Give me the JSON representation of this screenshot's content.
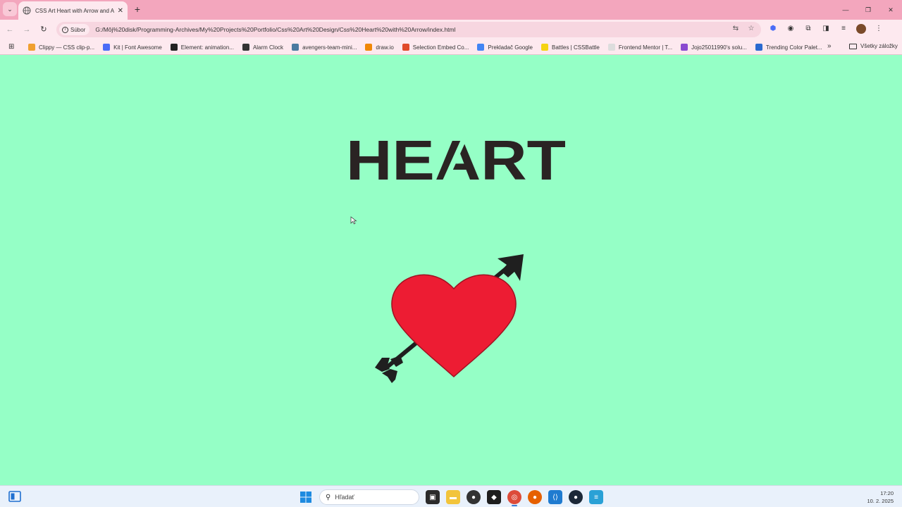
{
  "browser": {
    "tab": {
      "title": "CSS Art Heart with Arrow and A"
    },
    "address": {
      "chip": "Súbor",
      "url": "G:/Môj%20disk/Programming-Archives/My%20Projects%20Portfolio/Css%20Art%20Design/Css%20Heart%20with%20Arrow/index.html"
    },
    "bookmarks": [
      {
        "label": "Clippy — CSS clip-p...",
        "color": "#f0a030"
      },
      {
        "label": "Kit | Font Awesome",
        "color": "#4a6cf7"
      },
      {
        "label": "Element: animation...",
        "color": "#222222"
      },
      {
        "label": "Alarm Clock",
        "color": "#333333"
      },
      {
        "label": "avengers-team-mini...",
        "color": "#4a7aa0"
      },
      {
        "label": "draw.io",
        "color": "#f08705"
      },
      {
        "label": "Selection Embed Co...",
        "color": "#e04a2a"
      },
      {
        "label": "Prekladač Google",
        "color": "#4285f4"
      },
      {
        "label": "Battles | CSSBattle",
        "color": "#f5d312"
      },
      {
        "label": "Frontend Mentor | T...",
        "color": "#dddddd"
      },
      {
        "label": "Jojo25011990's solu...",
        "color": "#8a4ad0"
      },
      {
        "label": "Trending Color Palet...",
        "color": "#2a6ad0"
      }
    ],
    "bookmarks_more": "»",
    "bookmarks_folder": "Všetky záložky"
  },
  "page": {
    "heading": "HEART",
    "background": "#95ffc6",
    "heart_color": "#ed1c33",
    "arrow_color": "#1f1f1f",
    "text_color": "#2a2323"
  },
  "taskbar": {
    "search_placeholder": "Hľadať",
    "time": "17:20",
    "date": "10. 2. 2025"
  }
}
